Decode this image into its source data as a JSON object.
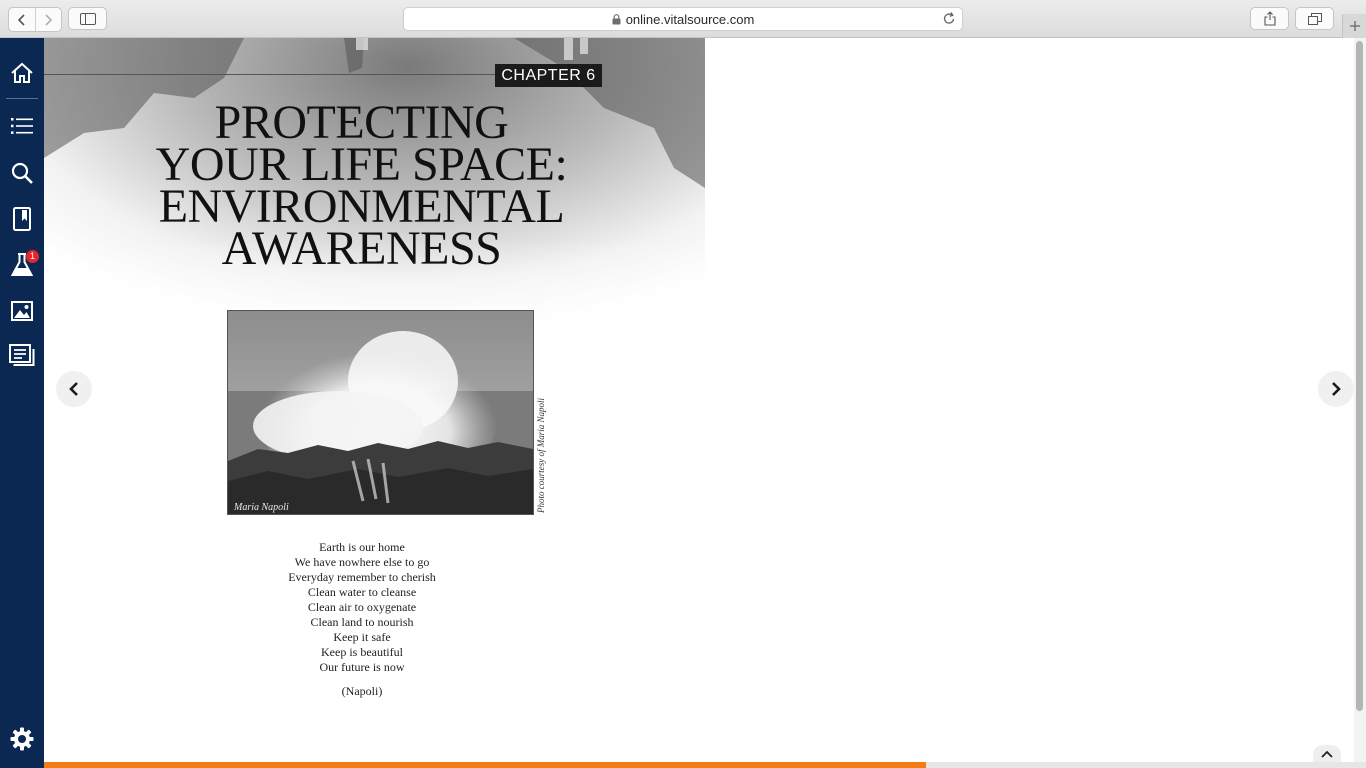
{
  "browser": {
    "url": "online.vitalsource.com",
    "icons": {
      "back": "chevron-left-icon",
      "forward": "chevron-right-icon",
      "sidebar": "sidebar-toggle-icon",
      "lock": "lock-icon",
      "reload": "reload-icon",
      "share": "share-icon",
      "tabs": "tabs-icon",
      "new_tab": "plus-icon"
    }
  },
  "sidebar": {
    "items": [
      {
        "name": "home",
        "icon": "home-icon"
      },
      {
        "name": "contents",
        "icon": "list-icon"
      },
      {
        "name": "search",
        "icon": "search-icon"
      },
      {
        "name": "bookmarks",
        "icon": "bookmark-icon"
      },
      {
        "name": "lab",
        "icon": "flask-icon",
        "badge": "1"
      },
      {
        "name": "figures",
        "icon": "image-icon"
      },
      {
        "name": "notes",
        "icon": "notes-icon"
      }
    ],
    "settings_icon": "gear-icon",
    "colors": {
      "background": "#0a2852",
      "badge": "#e3262a"
    }
  },
  "page": {
    "chapter_label": "CHAPTER 6",
    "title_lines": [
      "PROTECTING",
      "YOUR LIFE SPACE:",
      "ENVIRONMENTAL",
      "AWARENESS"
    ],
    "photo_signature": "Maria Napoli",
    "photo_credit": "Photo courtesy of Maria Napoli",
    "poem": [
      "Earth is our home",
      "We have nowhere else to go",
      "Everyday remember to cherish",
      "Clean water to cleanse",
      "Clean air to oxygenate",
      "Clean land to nourish",
      "Keep it safe",
      "Keep is beautiful",
      "Our future is now"
    ],
    "attribution": "(Napoli)"
  },
  "navigation": {
    "prev_icon": "chevron-left-icon",
    "next_icon": "chevron-right-icon",
    "collapse_icon": "chevron-up-icon"
  },
  "progress": {
    "fraction": 0.667,
    "color": "#f47c14"
  }
}
